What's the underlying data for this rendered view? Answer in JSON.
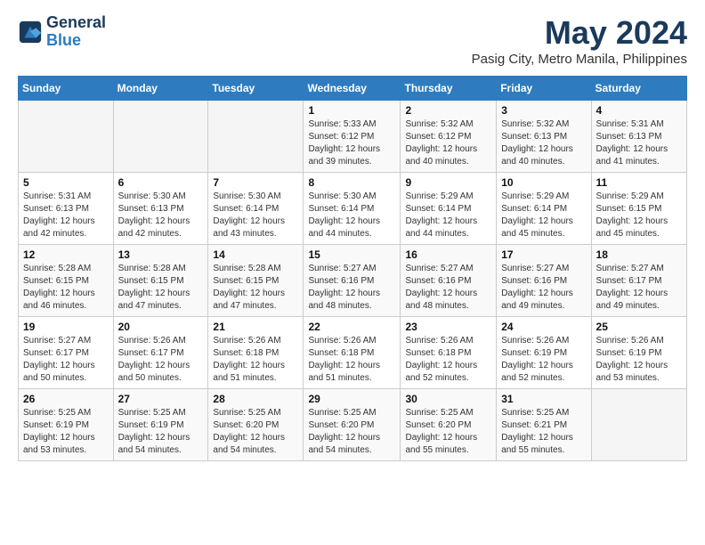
{
  "header": {
    "logo_line1": "General",
    "logo_line2": "Blue",
    "month_year": "May 2024",
    "location": "Pasig City, Metro Manila, Philippines"
  },
  "weekdays": [
    "Sunday",
    "Monday",
    "Tuesday",
    "Wednesday",
    "Thursday",
    "Friday",
    "Saturday"
  ],
  "weeks": [
    [
      {
        "day": "",
        "sunrise": "",
        "sunset": "",
        "daylight": ""
      },
      {
        "day": "",
        "sunrise": "",
        "sunset": "",
        "daylight": ""
      },
      {
        "day": "",
        "sunrise": "",
        "sunset": "",
        "daylight": ""
      },
      {
        "day": "1",
        "sunrise": "Sunrise: 5:33 AM",
        "sunset": "Sunset: 6:12 PM",
        "daylight": "Daylight: 12 hours and 39 minutes."
      },
      {
        "day": "2",
        "sunrise": "Sunrise: 5:32 AM",
        "sunset": "Sunset: 6:12 PM",
        "daylight": "Daylight: 12 hours and 40 minutes."
      },
      {
        "day": "3",
        "sunrise": "Sunrise: 5:32 AM",
        "sunset": "Sunset: 6:13 PM",
        "daylight": "Daylight: 12 hours and 40 minutes."
      },
      {
        "day": "4",
        "sunrise": "Sunrise: 5:31 AM",
        "sunset": "Sunset: 6:13 PM",
        "daylight": "Daylight: 12 hours and 41 minutes."
      }
    ],
    [
      {
        "day": "5",
        "sunrise": "Sunrise: 5:31 AM",
        "sunset": "Sunset: 6:13 PM",
        "daylight": "Daylight: 12 hours and 42 minutes."
      },
      {
        "day": "6",
        "sunrise": "Sunrise: 5:30 AM",
        "sunset": "Sunset: 6:13 PM",
        "daylight": "Daylight: 12 hours and 42 minutes."
      },
      {
        "day": "7",
        "sunrise": "Sunrise: 5:30 AM",
        "sunset": "Sunset: 6:14 PM",
        "daylight": "Daylight: 12 hours and 43 minutes."
      },
      {
        "day": "8",
        "sunrise": "Sunrise: 5:30 AM",
        "sunset": "Sunset: 6:14 PM",
        "daylight": "Daylight: 12 hours and 44 minutes."
      },
      {
        "day": "9",
        "sunrise": "Sunrise: 5:29 AM",
        "sunset": "Sunset: 6:14 PM",
        "daylight": "Daylight: 12 hours and 44 minutes."
      },
      {
        "day": "10",
        "sunrise": "Sunrise: 5:29 AM",
        "sunset": "Sunset: 6:14 PM",
        "daylight": "Daylight: 12 hours and 45 minutes."
      },
      {
        "day": "11",
        "sunrise": "Sunrise: 5:29 AM",
        "sunset": "Sunset: 6:15 PM",
        "daylight": "Daylight: 12 hours and 45 minutes."
      }
    ],
    [
      {
        "day": "12",
        "sunrise": "Sunrise: 5:28 AM",
        "sunset": "Sunset: 6:15 PM",
        "daylight": "Daylight: 12 hours and 46 minutes."
      },
      {
        "day": "13",
        "sunrise": "Sunrise: 5:28 AM",
        "sunset": "Sunset: 6:15 PM",
        "daylight": "Daylight: 12 hours and 47 minutes."
      },
      {
        "day": "14",
        "sunrise": "Sunrise: 5:28 AM",
        "sunset": "Sunset: 6:15 PM",
        "daylight": "Daylight: 12 hours and 47 minutes."
      },
      {
        "day": "15",
        "sunrise": "Sunrise: 5:27 AM",
        "sunset": "Sunset: 6:16 PM",
        "daylight": "Daylight: 12 hours and 48 minutes."
      },
      {
        "day": "16",
        "sunrise": "Sunrise: 5:27 AM",
        "sunset": "Sunset: 6:16 PM",
        "daylight": "Daylight: 12 hours and 48 minutes."
      },
      {
        "day": "17",
        "sunrise": "Sunrise: 5:27 AM",
        "sunset": "Sunset: 6:16 PM",
        "daylight": "Daylight: 12 hours and 49 minutes."
      },
      {
        "day": "18",
        "sunrise": "Sunrise: 5:27 AM",
        "sunset": "Sunset: 6:17 PM",
        "daylight": "Daylight: 12 hours and 49 minutes."
      }
    ],
    [
      {
        "day": "19",
        "sunrise": "Sunrise: 5:27 AM",
        "sunset": "Sunset: 6:17 PM",
        "daylight": "Daylight: 12 hours and 50 minutes."
      },
      {
        "day": "20",
        "sunrise": "Sunrise: 5:26 AM",
        "sunset": "Sunset: 6:17 PM",
        "daylight": "Daylight: 12 hours and 50 minutes."
      },
      {
        "day": "21",
        "sunrise": "Sunrise: 5:26 AM",
        "sunset": "Sunset: 6:18 PM",
        "daylight": "Daylight: 12 hours and 51 minutes."
      },
      {
        "day": "22",
        "sunrise": "Sunrise: 5:26 AM",
        "sunset": "Sunset: 6:18 PM",
        "daylight": "Daylight: 12 hours and 51 minutes."
      },
      {
        "day": "23",
        "sunrise": "Sunrise: 5:26 AM",
        "sunset": "Sunset: 6:18 PM",
        "daylight": "Daylight: 12 hours and 52 minutes."
      },
      {
        "day": "24",
        "sunrise": "Sunrise: 5:26 AM",
        "sunset": "Sunset: 6:19 PM",
        "daylight": "Daylight: 12 hours and 52 minutes."
      },
      {
        "day": "25",
        "sunrise": "Sunrise: 5:26 AM",
        "sunset": "Sunset: 6:19 PM",
        "daylight": "Daylight: 12 hours and 53 minutes."
      }
    ],
    [
      {
        "day": "26",
        "sunrise": "Sunrise: 5:25 AM",
        "sunset": "Sunset: 6:19 PM",
        "daylight": "Daylight: 12 hours and 53 minutes."
      },
      {
        "day": "27",
        "sunrise": "Sunrise: 5:25 AM",
        "sunset": "Sunset: 6:19 PM",
        "daylight": "Daylight: 12 hours and 54 minutes."
      },
      {
        "day": "28",
        "sunrise": "Sunrise: 5:25 AM",
        "sunset": "Sunset: 6:20 PM",
        "daylight": "Daylight: 12 hours and 54 minutes."
      },
      {
        "day": "29",
        "sunrise": "Sunrise: 5:25 AM",
        "sunset": "Sunset: 6:20 PM",
        "daylight": "Daylight: 12 hours and 54 minutes."
      },
      {
        "day": "30",
        "sunrise": "Sunrise: 5:25 AM",
        "sunset": "Sunset: 6:20 PM",
        "daylight": "Daylight: 12 hours and 55 minutes."
      },
      {
        "day": "31",
        "sunrise": "Sunrise: 5:25 AM",
        "sunset": "Sunset: 6:21 PM",
        "daylight": "Daylight: 12 hours and 55 minutes."
      },
      {
        "day": "",
        "sunrise": "",
        "sunset": "",
        "daylight": ""
      }
    ]
  ]
}
